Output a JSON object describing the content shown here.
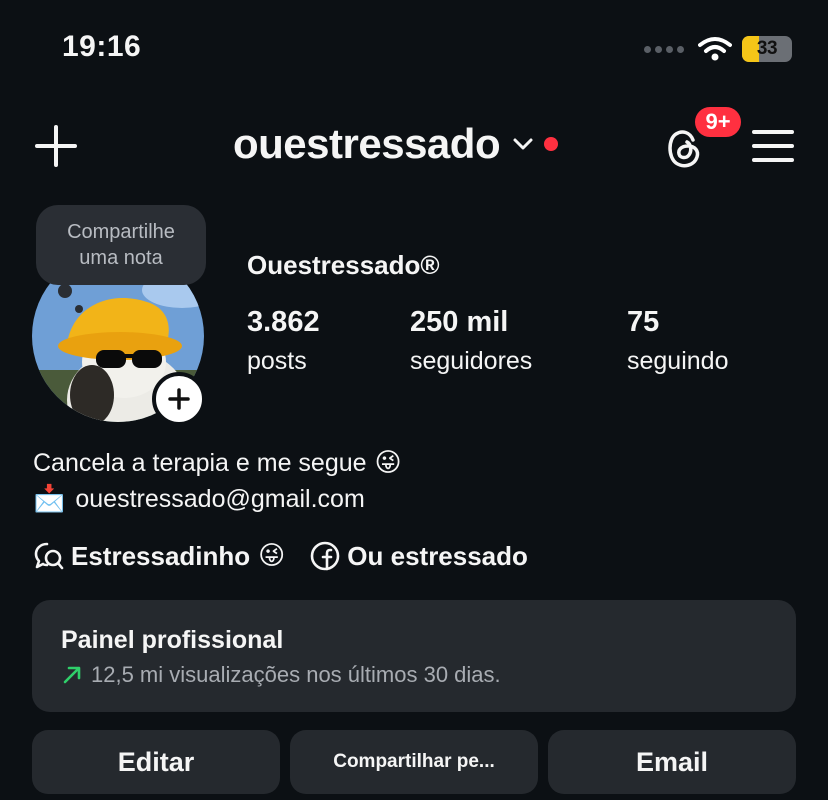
{
  "status_bar": {
    "time": "19:16",
    "battery": "33",
    "battery_level_pct": 33,
    "battery_color": "#f5c518"
  },
  "header": {
    "username": "ouestressado",
    "notification_badge": "9+",
    "icons": [
      "plus-icon",
      "chevron-down-icon",
      "threads-icon",
      "menu-icon"
    ],
    "accent_color": "#ff3040"
  },
  "profile": {
    "note_prompt_line1": "Compartilhe",
    "note_prompt_line2": "uma nota",
    "display_name": "Ouestressado®",
    "stats": {
      "posts_count": "3.862",
      "posts_label": "posts",
      "followers_count": "250 mil",
      "followers_label": "seguidores",
      "following_count": "75",
      "following_label": "seguindo"
    }
  },
  "bio": {
    "line1": "Cancela a terapia e me segue",
    "line1_emoji": "😜",
    "line2_emoji": "📩",
    "email": "ouestressado@gmail.com"
  },
  "links": {
    "threads_label": "Estressadinho",
    "threads_emoji": "😜",
    "facebook_label": "Ou estressado"
  },
  "dashboard": {
    "title": "Painel profissional",
    "subtitle": "12,5 mi visualizações nos últimos 30 dias.",
    "trend_color": "#2fcf6a"
  },
  "actions": {
    "edit": "Editar",
    "share": "Compartilhar pe...",
    "email": "Email"
  }
}
